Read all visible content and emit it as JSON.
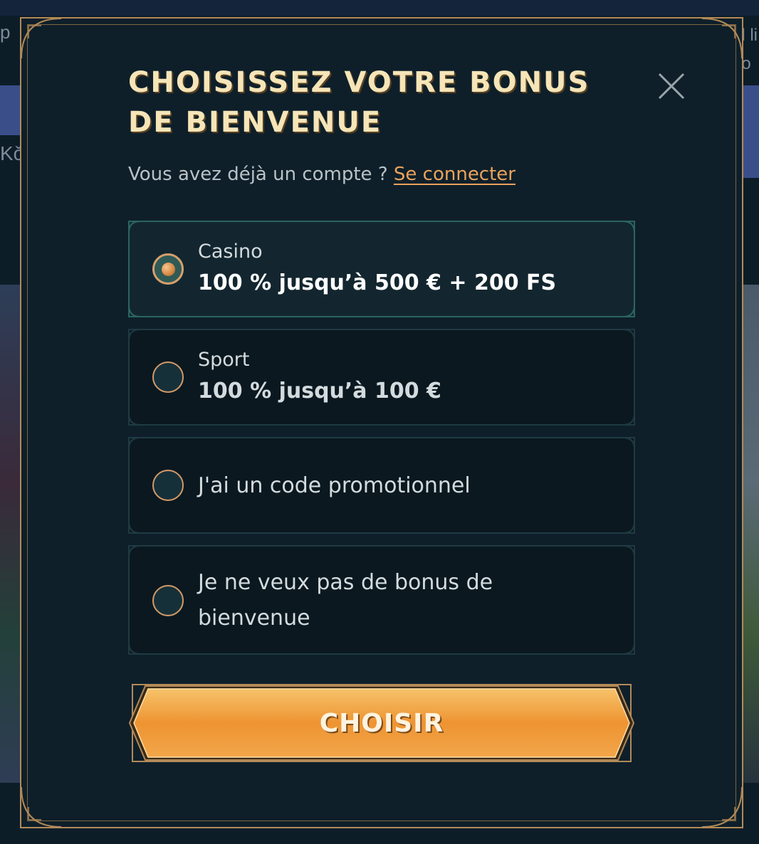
{
  "background": {
    "left_text_top": "p",
    "left_text_mid": "Kč",
    "right_text_top": "l li\no"
  },
  "modal": {
    "title": "Choisissez votre bonus de bienvenue",
    "subtitle_prefix": "Vous avez déjà un compte ? ",
    "login_link": "Se connecter",
    "close_icon": "close-icon",
    "options": [
      {
        "label": "Casino",
        "value": "100 % jusqu’à 500 € + 200 FS",
        "selected": true
      },
      {
        "label": "Sport",
        "value": "100 % jusqu’à 100 €",
        "selected": false
      },
      {
        "label": "J'ai un code promotionnel",
        "selected": false
      },
      {
        "label": "Je ne veux pas de bonus de bienvenue",
        "selected": false
      }
    ],
    "submit_label": "CHOISIR"
  },
  "colors": {
    "gold": "#b28a58",
    "title": "#f5e5b8",
    "link": "#e9a25b",
    "button": "#f0a23c",
    "modal_bg": "#0e1f2a"
  }
}
